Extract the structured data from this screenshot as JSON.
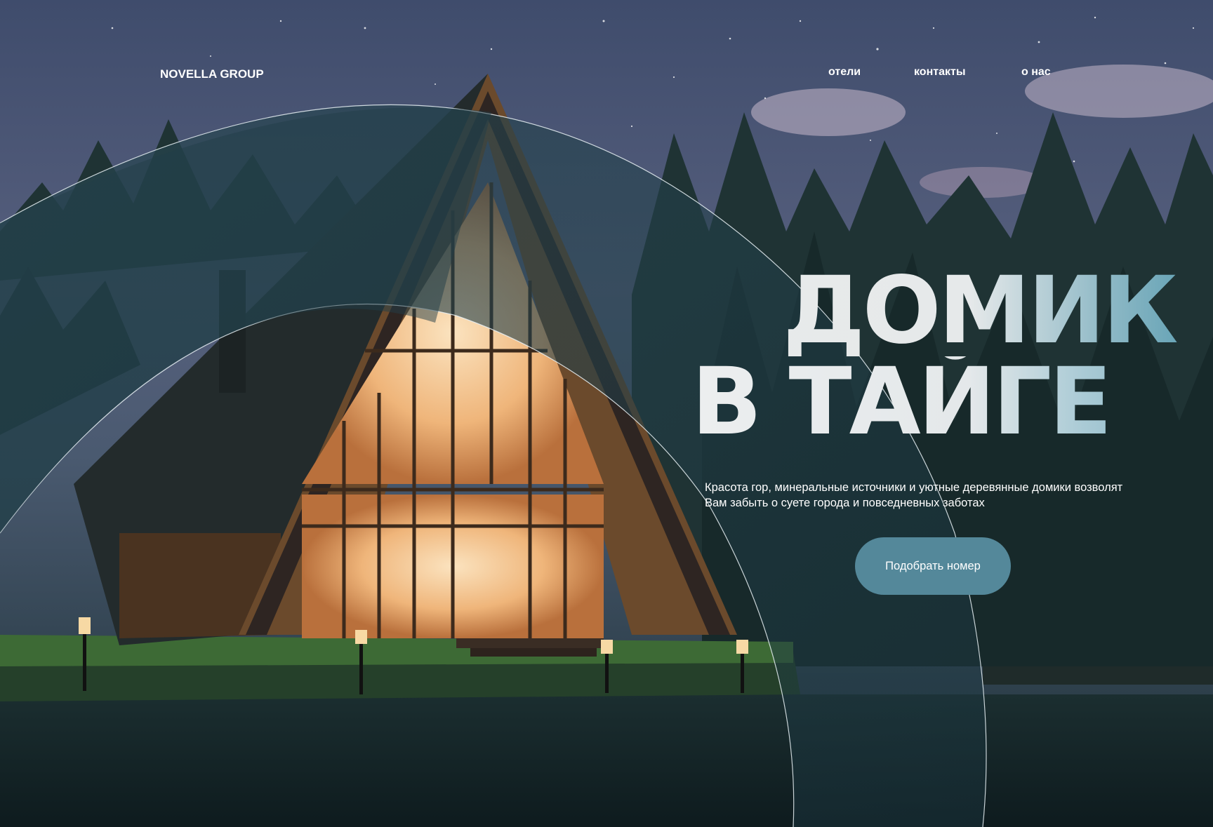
{
  "nav": {
    "logo": "NOVELLA GROUP",
    "links": [
      {
        "label": "отели"
      },
      {
        "label": "контакты"
      },
      {
        "label": "о нас"
      }
    ]
  },
  "hero": {
    "title_line_1": "ДОМИК",
    "title_line_2": "В ТАЙГЕ",
    "description": "Красота гор, минеральные источники и уютные деревянные домики возволят Вам забыть о суете города и повседневных заботах",
    "cta_label": "Подобрать номер"
  },
  "colors": {
    "accent": "#54889a",
    "night_sky": "#4b5a7a",
    "panel_tint": "#1e3a44",
    "window_glow": "#f3c18a"
  }
}
